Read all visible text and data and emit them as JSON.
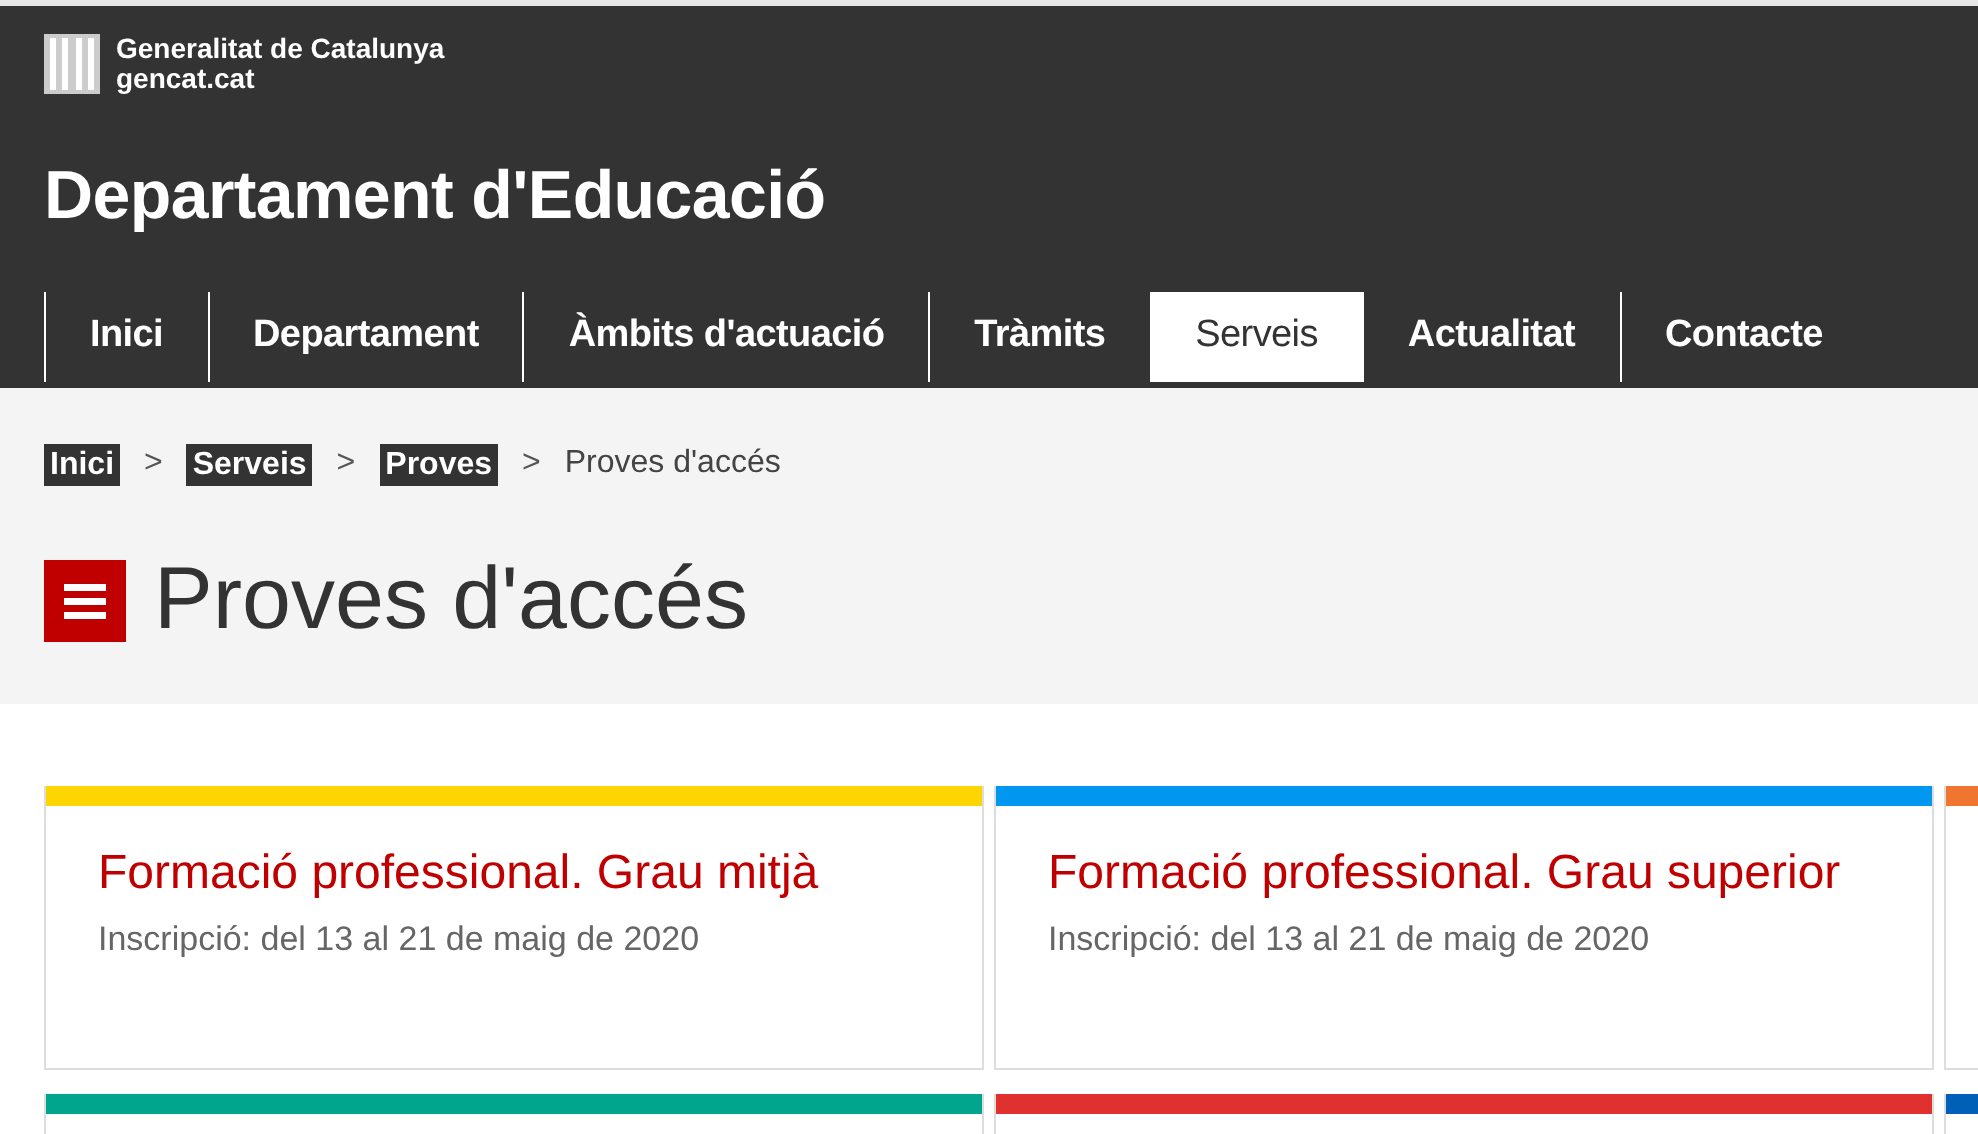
{
  "brand": {
    "name": "Generalitat de Catalunya",
    "site": "gencat.cat"
  },
  "site_title": "Departament d'Educació",
  "tabs": [
    {
      "label": "Inici",
      "selected": false
    },
    {
      "label": "Departament",
      "selected": false
    },
    {
      "label": "Àmbits d'actuació",
      "selected": false
    },
    {
      "label": "Tràmits",
      "selected": false
    },
    {
      "label": "Serveis",
      "selected": true
    },
    {
      "label": "Actualitat",
      "selected": false
    },
    {
      "label": "Contacte",
      "selected": false
    }
  ],
  "breadcrumb_separator": ">",
  "breadcrumb": [
    {
      "label": "Inici",
      "kind": "link"
    },
    {
      "label": "Serveis",
      "kind": "link"
    },
    {
      "label": "Proves",
      "kind": "link"
    },
    {
      "label": "Proves d'accés",
      "kind": "current"
    }
  ],
  "page_title": "Proves d'accés",
  "cards": [
    {
      "color": "#ffd500",
      "title": "Formació professional. Grau mitjà",
      "detail": "Inscripció: del 13 al 21 de maig de 2020"
    },
    {
      "color": "#0097f0",
      "title": "Formació professional. Grau superior",
      "detail": "Inscripció: del 13 al 21 de maig de 2020"
    },
    {
      "color": "#f07530"
    },
    {
      "color": "#00a58e"
    },
    {
      "color": "#e03030"
    },
    {
      "color": "#0060b8"
    }
  ]
}
